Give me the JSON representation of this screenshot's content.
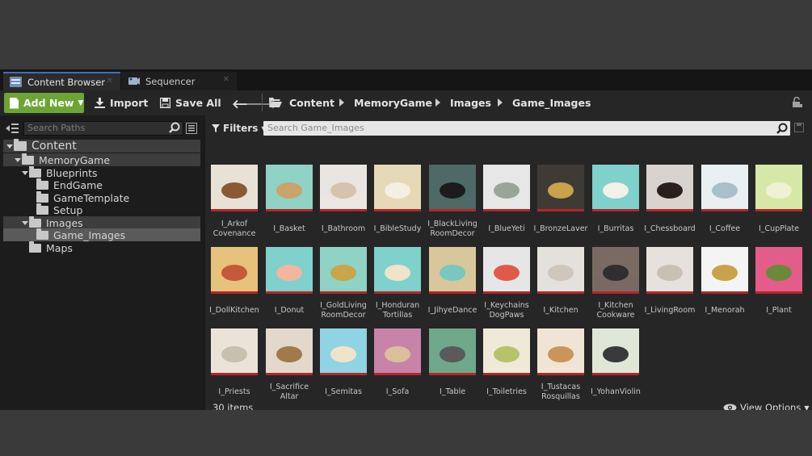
{
  "tabs": [
    {
      "label": "Content Browser",
      "active": true
    },
    {
      "label": "Sequencer",
      "active": false
    }
  ],
  "toolbar": {
    "add_new_label": "Add New",
    "import_label": "Import",
    "save_all_label": "Save All"
  },
  "breadcrumb": [
    "Content",
    "MemoryGame",
    "Images",
    "Game_Images"
  ],
  "left_panel": {
    "search_placeholder": "Search Paths",
    "tree": [
      {
        "label": "Content",
        "level": 0,
        "expanded": true
      },
      {
        "label": "MemoryGame",
        "level": 1,
        "expanded": true
      },
      {
        "label": "Blueprints",
        "level": 2,
        "expanded": true
      },
      {
        "label": "EndGame",
        "level": 3
      },
      {
        "label": "GameTemplate",
        "level": 3
      },
      {
        "label": "Setup",
        "level": 3
      },
      {
        "label": "Images",
        "level": 2,
        "expanded": true
      },
      {
        "label": "Game_Images",
        "level": 3,
        "selected": true
      },
      {
        "label": "Maps",
        "level": 2
      }
    ]
  },
  "right_panel": {
    "filters_label": "Filters",
    "search_placeholder": "Search Game_Images",
    "item_count": "30 items",
    "view_options_label": "View Options"
  },
  "assets": [
    {
      "label": "I_Arkof\nCovenance",
      "icon": "ark-thumbnail"
    },
    {
      "label": "I_Basket",
      "icon": "basket-thumbnail"
    },
    {
      "label": "I_Bathroom",
      "icon": "bathroom-thumbnail"
    },
    {
      "label": "I_BibleStudy",
      "icon": "bible-study-thumbnail"
    },
    {
      "label": "I_BlackLiving\nRoomDecor",
      "icon": "black-decor-thumbnail"
    },
    {
      "label": "I_BlueYeti",
      "icon": "microphone-thumbnail"
    },
    {
      "label": "I_BronzeLaver",
      "icon": "laver-thumbnail"
    },
    {
      "label": "I_Burritas",
      "icon": "burritas-thumbnail"
    },
    {
      "label": "I_Chessboard",
      "icon": "chessboard-thumbnail"
    },
    {
      "label": "I_Coffee",
      "icon": "coffee-thumbnail"
    },
    {
      "label": "I_CupPlate",
      "icon": "cup-plate-thumbnail"
    },
    {
      "label": "I_DollKitchen",
      "icon": "doll-kitchen-thumbnail"
    },
    {
      "label": "I_Donut",
      "icon": "donut-thumbnail"
    },
    {
      "label": "I_GoldLiving\nRoomDecor",
      "icon": "gold-decor-thumbnail"
    },
    {
      "label": "I_Honduran\nTortillas",
      "icon": "tortillas-thumbnail"
    },
    {
      "label": "I_JihyeDance",
      "icon": "dance-thumbnail"
    },
    {
      "label": "I_Keychains\nDogPaws",
      "icon": "keychains-thumbnail"
    },
    {
      "label": "I_Kitchen",
      "icon": "kitchen-thumbnail"
    },
    {
      "label": "I_Kitchen\nCookware",
      "icon": "cookware-thumbnail"
    },
    {
      "label": "I_LivingRoom",
      "icon": "living-room-thumbnail"
    },
    {
      "label": "I_Menorah",
      "icon": "menorah-thumbnail"
    },
    {
      "label": "I_Plant",
      "icon": "plant-thumbnail"
    },
    {
      "label": "I_Priests",
      "icon": "priests-thumbnail"
    },
    {
      "label": "I_Sacrifice\nAltar",
      "icon": "altar-thumbnail"
    },
    {
      "label": "I_Semitas",
      "icon": "semitas-thumbnail"
    },
    {
      "label": "I_Sofa",
      "icon": "sofa-thumbnail"
    },
    {
      "label": "I_Table",
      "icon": "table-thumbnail"
    },
    {
      "label": "I_Toiletries",
      "icon": "toiletries-thumbnail"
    },
    {
      "label": "I_Tustacas\nRosquillas",
      "icon": "tustacas-thumbnail"
    },
    {
      "label": "I_YohanViolin",
      "icon": "violin-thumbnail"
    }
  ],
  "colors": {
    "add_new": "#6da534",
    "asset_underline": "#b3272a",
    "active_tab_accent": "#3f6fb5"
  }
}
